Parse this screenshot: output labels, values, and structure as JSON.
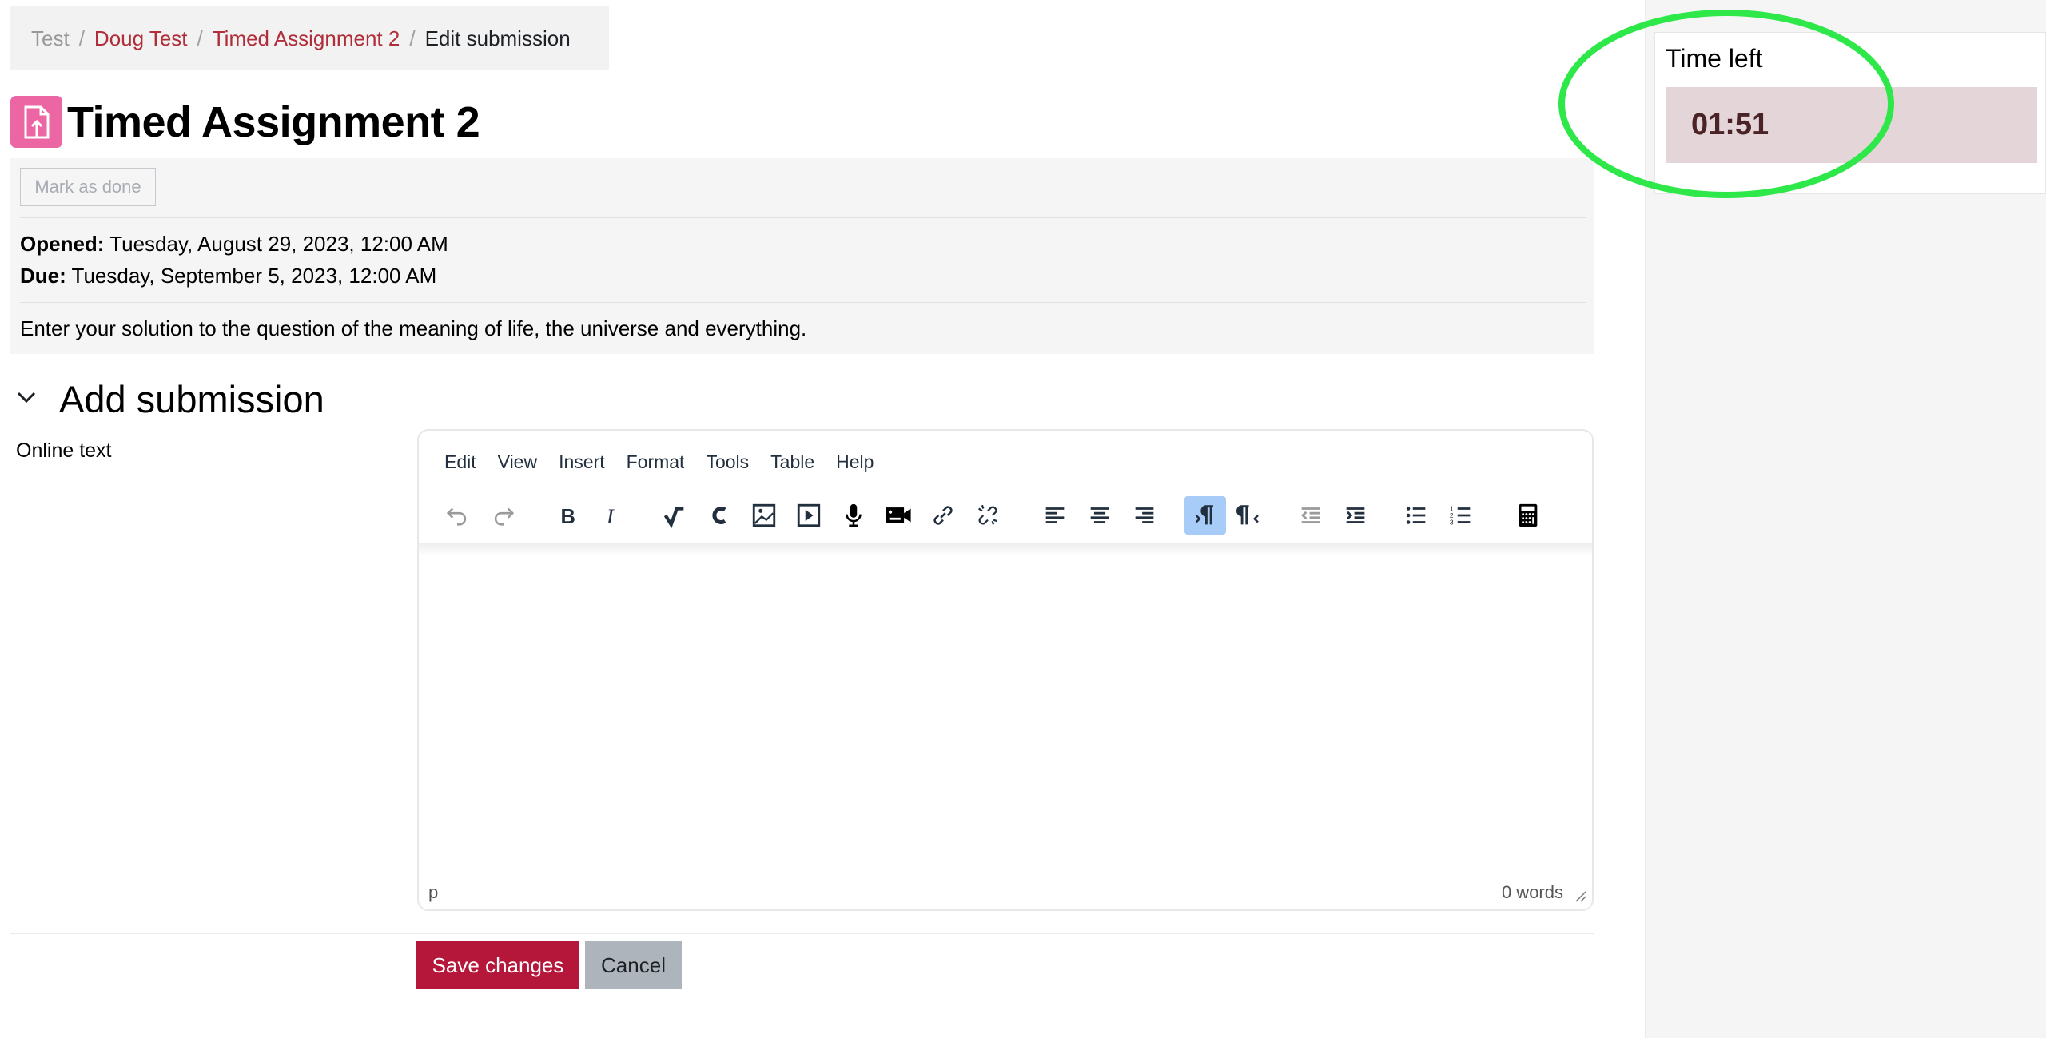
{
  "breadcrumb": {
    "items": [
      "Test",
      "Doug Test",
      "Timed Assignment 2",
      "Edit submission"
    ],
    "separator": "/"
  },
  "page": {
    "title": "Timed Assignment 2",
    "icon": "assignment-upload-icon",
    "icon_color": "#eb66a2"
  },
  "activity": {
    "mark_done_label": "Mark as done",
    "opened_label": "Opened:",
    "opened_value": "Tuesday, August 29, 2023, 12:00 AM",
    "due_label": "Due:",
    "due_value": "Tuesday, September 5, 2023, 12:00 AM",
    "description": "Enter your solution to the question of the meaning of life, the universe and everything."
  },
  "section": {
    "title": "Add submission",
    "online_text_label": "Online text"
  },
  "editor": {
    "menus": [
      "Edit",
      "View",
      "Insert",
      "Format",
      "Tools",
      "Table",
      "Help"
    ],
    "toolbar": [
      {
        "name": "undo-icon",
        "active": false,
        "disabled": true
      },
      {
        "name": "redo-icon",
        "active": false,
        "disabled": true
      },
      {
        "name": "bold-icon",
        "active": false
      },
      {
        "name": "italic-icon",
        "active": false
      },
      {
        "name": "equation-icon",
        "active": false
      },
      {
        "name": "chemistry-icon",
        "active": false
      },
      {
        "name": "image-icon",
        "active": false
      },
      {
        "name": "media-icon",
        "active": false
      },
      {
        "name": "record-audio-icon",
        "active": false
      },
      {
        "name": "record-video-icon",
        "active": false
      },
      {
        "name": "link-icon",
        "active": false
      },
      {
        "name": "unlink-icon",
        "active": false
      },
      {
        "name": "align-left-icon",
        "active": false
      },
      {
        "name": "align-center-icon",
        "active": false
      },
      {
        "name": "align-right-icon",
        "active": false
      },
      {
        "name": "ltr-icon",
        "active": true
      },
      {
        "name": "rtl-icon",
        "active": false
      },
      {
        "name": "outdent-icon",
        "active": false,
        "disabled": true
      },
      {
        "name": "indent-icon",
        "active": false
      },
      {
        "name": "bullet-list-icon",
        "active": false
      },
      {
        "name": "numbered-list-icon",
        "active": false
      },
      {
        "name": "calculator-icon",
        "active": false
      }
    ],
    "status_path": "p",
    "word_count": "0 words",
    "content": ""
  },
  "buttons": {
    "save": "Save changes",
    "cancel": "Cancel"
  },
  "timer": {
    "title": "Time left",
    "value": "01:51"
  },
  "colors": {
    "link": "#b02e3a",
    "primary_button": "#b5173a",
    "secondary_button": "#aeb4bb",
    "timer_bg": "#e4d6d8",
    "annotation": "#2ee84a",
    "active_toolbar": "#a6ccf7"
  }
}
